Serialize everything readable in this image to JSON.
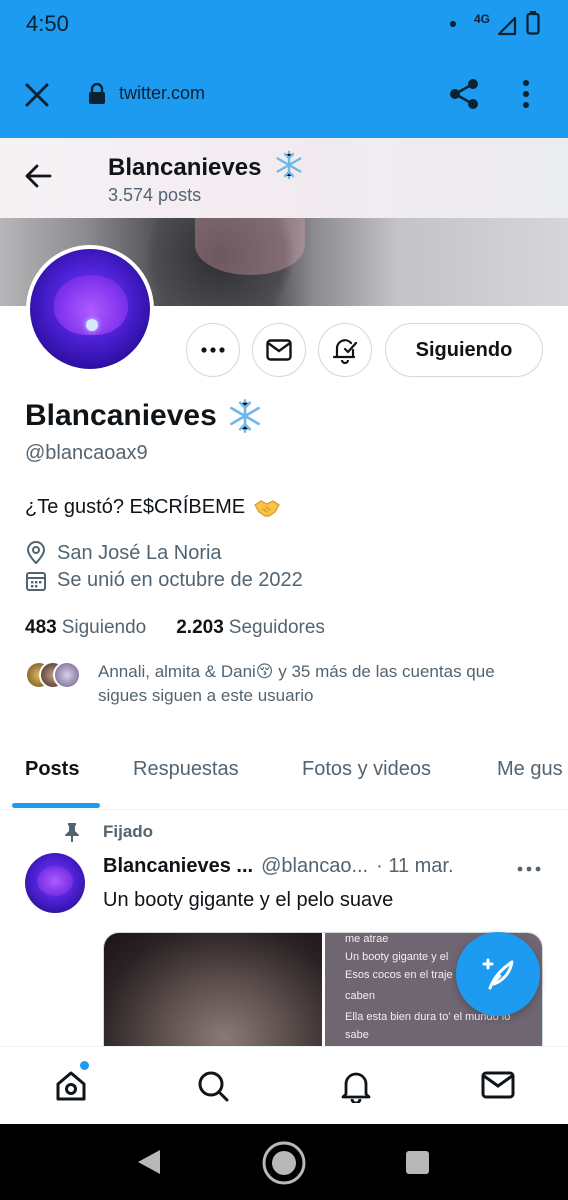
{
  "status_bar": {
    "time": "4:50",
    "network": "4G"
  },
  "browser": {
    "url": "twitter.com"
  },
  "header": {
    "name": "Blancanieves",
    "posts_count": "3.574 posts"
  },
  "profile": {
    "display_name": "Blancanieves",
    "handle": "@blancaoax9",
    "bio": "¿Te gustó? E$CRÍBEME",
    "location": "San José La Noria",
    "joined": "Se unió en octubre de 2022",
    "following_count": "483",
    "following_label": "Siguiendo",
    "followers_count": "2.203",
    "followers_label": "Seguidores",
    "followed_by_text": "Annali, almita & Dani😚 y 35 más de las cuentas que sigues siguen a este usuario",
    "follow_button_label": "Siguiendo"
  },
  "tabs": [
    {
      "label": "Posts",
      "active": true
    },
    {
      "label": "Respuestas",
      "active": false
    },
    {
      "label": "Fotos y videos",
      "active": false
    },
    {
      "label": "Me gus",
      "active": false
    }
  ],
  "tweet": {
    "pinned_label": "Fijado",
    "author": "Blancanieves ...",
    "handle": "@blancao...",
    "time": "· 11 mar.",
    "text": "Un booty gigante y el pelo suave",
    "media_text_lines": [
      "me atrae",
      "Un booty gigante y el",
      "Esos cocos en el traje",
      "caben",
      "Ella esta bien dura to' el mundo lo",
      "sabe"
    ]
  },
  "colors": {
    "accent": "#1d9bf0",
    "text_primary": "#0f1419",
    "text_secondary": "#536471",
    "border": "#cfd9de"
  },
  "icons": {
    "status": [
      "signal-icon",
      "battery-icon"
    ],
    "browser": [
      "close-icon",
      "lock-icon",
      "share-icon",
      "menu-icon"
    ],
    "profile": [
      "more-icon",
      "mail-icon",
      "bell-check-icon",
      "snowflake-icon",
      "handshake-icon",
      "location-icon",
      "calendar-icon",
      "pin-icon"
    ],
    "bottom_nav": [
      "home-icon",
      "search-icon",
      "notifications-icon",
      "messages-icon"
    ],
    "fab": "compose-icon",
    "system_nav": [
      "back-icon",
      "home-circle-icon",
      "recents-icon"
    ]
  }
}
